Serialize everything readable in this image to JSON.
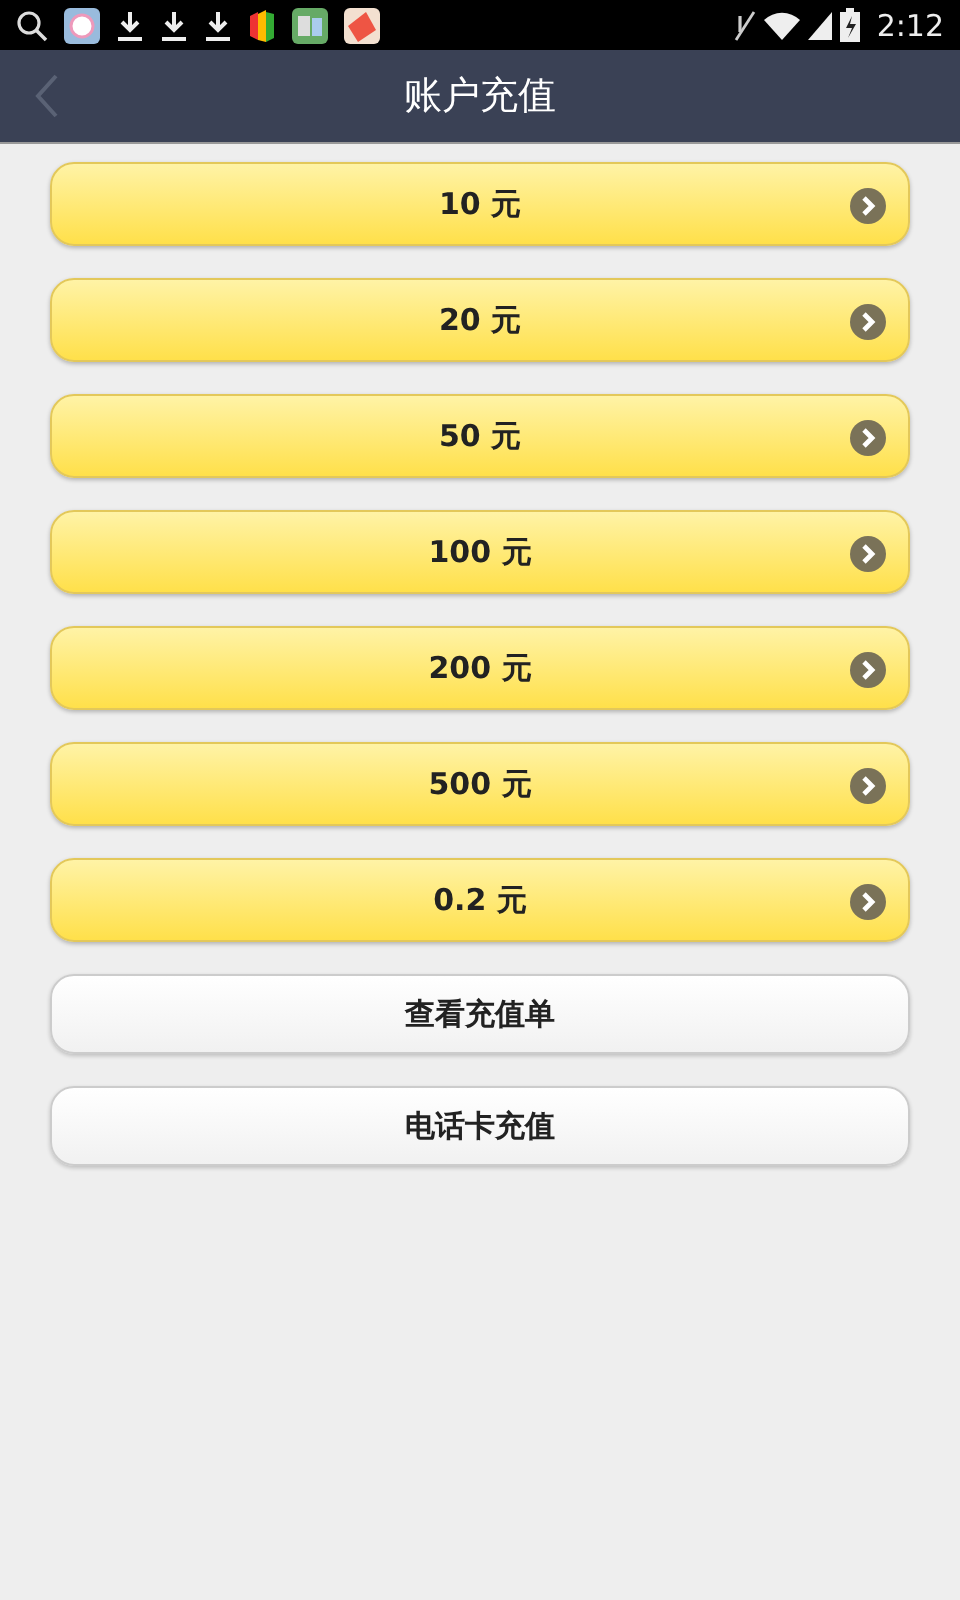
{
  "status_bar": {
    "time": "2:12"
  },
  "header": {
    "title": "账户充值"
  },
  "buttons": [
    {
      "label": "10 元",
      "kind": "amount"
    },
    {
      "label": "20 元",
      "kind": "amount"
    },
    {
      "label": "50 元",
      "kind": "amount"
    },
    {
      "label": "100 元",
      "kind": "amount"
    },
    {
      "label": "200 元",
      "kind": "amount"
    },
    {
      "label": "500 元",
      "kind": "amount"
    },
    {
      "label": "0.2 元",
      "kind": "amount"
    },
    {
      "label": "查看充值单",
      "kind": "plain"
    },
    {
      "label": "电话卡充值",
      "kind": "plain"
    }
  ]
}
